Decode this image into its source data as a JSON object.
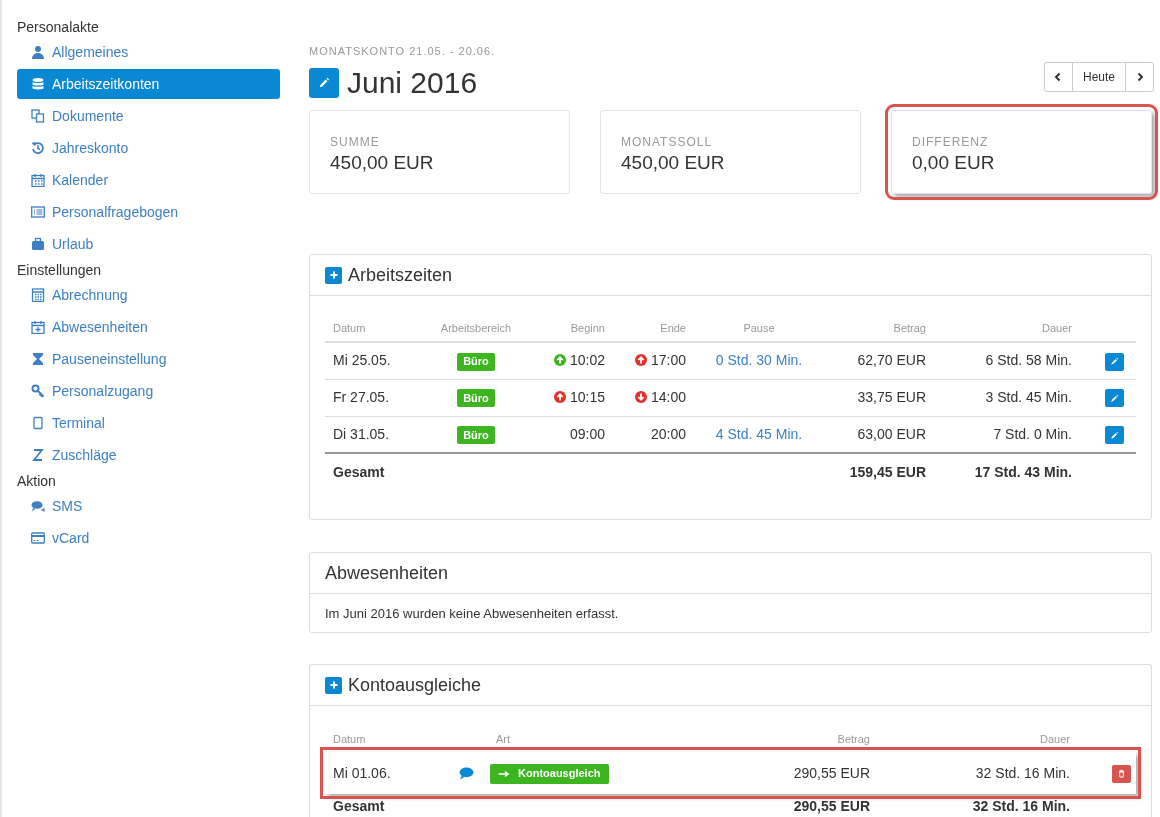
{
  "sidebar": {
    "sections": [
      {
        "heading": "Personalakte",
        "items": [
          {
            "label": "Allgemeines",
            "selected": false
          },
          {
            "label": "Arbeitszeitkonten",
            "selected": true
          },
          {
            "label": "Dokumente",
            "selected": false
          },
          {
            "label": "Jahreskonto",
            "selected": false
          },
          {
            "label": "Kalender",
            "selected": false
          },
          {
            "label": "Personalfragebogen",
            "selected": false
          },
          {
            "label": "Urlaub",
            "selected": false
          }
        ]
      },
      {
        "heading": "Einstellungen",
        "items": [
          {
            "label": "Abrechnung",
            "selected": false
          },
          {
            "label": "Abwesenheiten",
            "selected": false
          },
          {
            "label": "Pauseneinstellung",
            "selected": false
          },
          {
            "label": "Personalzugang",
            "selected": false
          },
          {
            "label": "Terminal",
            "selected": false
          },
          {
            "label": "Zuschläge",
            "selected": false
          }
        ]
      },
      {
        "heading": "Aktion",
        "items": [
          {
            "label": "SMS",
            "selected": false
          },
          {
            "label": "vCard",
            "selected": false
          }
        ]
      }
    ]
  },
  "header": {
    "period": "MONATSKONTO 21.05. - 20.06.",
    "title": "Juni 2016",
    "today_button": "Heute"
  },
  "summary": [
    {
      "label": "SUMME",
      "value": "450,00 EUR",
      "highlighted": false
    },
    {
      "label": "MONATSSOLL",
      "value": "450,00 EUR",
      "highlighted": false
    },
    {
      "label": "DIFFERENZ",
      "value": "0,00 EUR",
      "highlighted": true
    }
  ],
  "arbeitszeiten": {
    "title": "Arbeitszeiten",
    "columns": [
      "Datum",
      "Arbeitsbereich",
      "Beginn",
      "Ende",
      "Pause",
      "Betrag",
      "Dauer"
    ],
    "rows": [
      {
        "date": "Mi 25.05.",
        "area": "Büro",
        "begin": {
          "time": "10:02",
          "kind": "up",
          "color": "#3cb521"
        },
        "end": {
          "time": "17:00",
          "kind": "up",
          "color": "#e3302a"
        },
        "pause": "0 Std. 30 Min.",
        "amount": "62,70 EUR",
        "duration": "6 Std. 58 Min."
      },
      {
        "date": "Fr 27.05.",
        "area": "Büro",
        "begin": {
          "time": "10:15",
          "kind": "up",
          "color": "#e3302a"
        },
        "end": {
          "time": "14:00",
          "kind": "down",
          "color": "#e3302a"
        },
        "amount": "33,75 EUR",
        "duration": "3 Std. 45 Min."
      },
      {
        "date": "Di 31.05.",
        "area": "Büro",
        "begin": {
          "time": "09:00",
          "kind": "plain"
        },
        "end": {
          "time": "20:00",
          "kind": "plain"
        },
        "pause": "4 Std. 45 Min.",
        "amount": "63,00 EUR",
        "duration": "7 Std. 0 Min."
      }
    ],
    "total": {
      "label": "Gesamt",
      "amount": "159,45 EUR",
      "duration": "17 Std. 43 Min."
    }
  },
  "abwesenheiten": {
    "title": "Abwesenheiten",
    "message": "Im Juni 2016 wurden keine Abwesenheiten erfasst."
  },
  "kontoausgleiche": {
    "title": "Kontoausgleiche",
    "columns": [
      "Datum",
      "Art",
      "Betrag",
      "Dauer"
    ],
    "rows": [
      {
        "date": "Mi 01.06.",
        "type": "Kontoausgleich",
        "amount": "290,55 EUR",
        "duration": "32 Std. 16 Min.",
        "highlighted": true
      }
    ],
    "total": {
      "label": "Gesamt",
      "amount": "290,55 EUR",
      "duration": "32 Std. 16 Min."
    }
  }
}
